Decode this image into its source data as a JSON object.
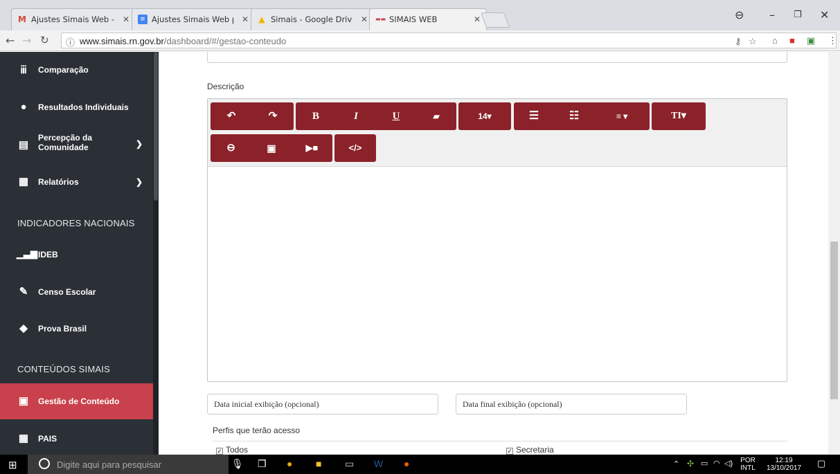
{
  "browser": {
    "tabs": [
      {
        "title": "Ajustes Simais Web - rsil",
        "icon": "gmail-icon",
        "icon_color": "#d44638"
      },
      {
        "title": "Ajustes Simais Web pend",
        "icon": "docs-icon",
        "icon_color": "#4285f4"
      },
      {
        "title": "Simais - Google Drive",
        "icon": "drive-icon",
        "icon_color": "#f4b400"
      },
      {
        "title": "SIMAIS WEB",
        "icon": "simais-icon",
        "icon_color": "#c9414c"
      }
    ],
    "url_host": "www.simais.rn.gov.br",
    "url_path": "/dashboard/#/gestao-conteudo"
  },
  "sidebar": {
    "items": [
      {
        "label": "Comparação",
        "icon": "bar-chart-icon"
      },
      {
        "label": "Resultados Individuais",
        "icon": "user-pin-icon"
      },
      {
        "label_line1": "Percepção da",
        "label_line2": "Comunidade",
        "icon": "document-icon"
      },
      {
        "label": "Relatórios",
        "icon": "clipboard-icon"
      },
      {
        "label": "IDEB",
        "icon": "signal-bars-icon"
      },
      {
        "label": "Censo Escolar",
        "icon": "pencil-icon"
      },
      {
        "label": "Prova Brasil",
        "icon": "map-icon"
      },
      {
        "label": "Gestão de Conteúdo",
        "icon": "newspaper-icon"
      },
      {
        "label": "PAIS",
        "icon": "clipboard-icon"
      }
    ],
    "sections": {
      "indicadores": "INDICADORES NACIONAIS",
      "conteudos": "CONTEÚDOS SIMAIS"
    },
    "active_color": "#c9414c",
    "bg_color": "#2b2f36"
  },
  "form": {
    "descricao_label": "Descrição",
    "toolbar": {
      "font_size_label": "14▾",
      "color": "#8b2229"
    },
    "data_inicial_placeholder": "Data inicial exibição (opcional)",
    "data_final_placeholder": "Data final exibição (opcional)",
    "perfis_label": "Perfis que terão acesso",
    "perfis": [
      {
        "label": "Todos",
        "checked": true
      },
      {
        "label": "Secretaria",
        "checked": true
      }
    ]
  },
  "taskbar": {
    "search_placeholder": "Digite aqui para pesquisar",
    "lang_line1": "POR",
    "lang_line2": "INTL",
    "time": "12:19",
    "date": "13/10/2017"
  }
}
